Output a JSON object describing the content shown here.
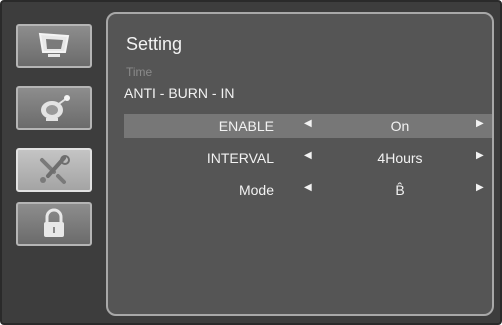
{
  "menu": {
    "title": "Setting",
    "subtitle": "Time",
    "section": "ANTI - BURN - IN",
    "rows": [
      {
        "label": "ENABLE",
        "value": "On"
      },
      {
        "label": "INTERVAL",
        "value": "4Hours"
      },
      {
        "label": "Mode",
        "value": "B̂"
      }
    ]
  },
  "sidebar": {
    "items": [
      {
        "icon": "monitor-icon"
      },
      {
        "icon": "satellite-dish-icon"
      },
      {
        "icon": "tools-icon",
        "active": true
      },
      {
        "icon": "lock-icon"
      }
    ]
  },
  "colors": {
    "background": "#3d3d3d",
    "panel": "#555555",
    "highlight": "#777777",
    "text": "#f2f2f2"
  }
}
